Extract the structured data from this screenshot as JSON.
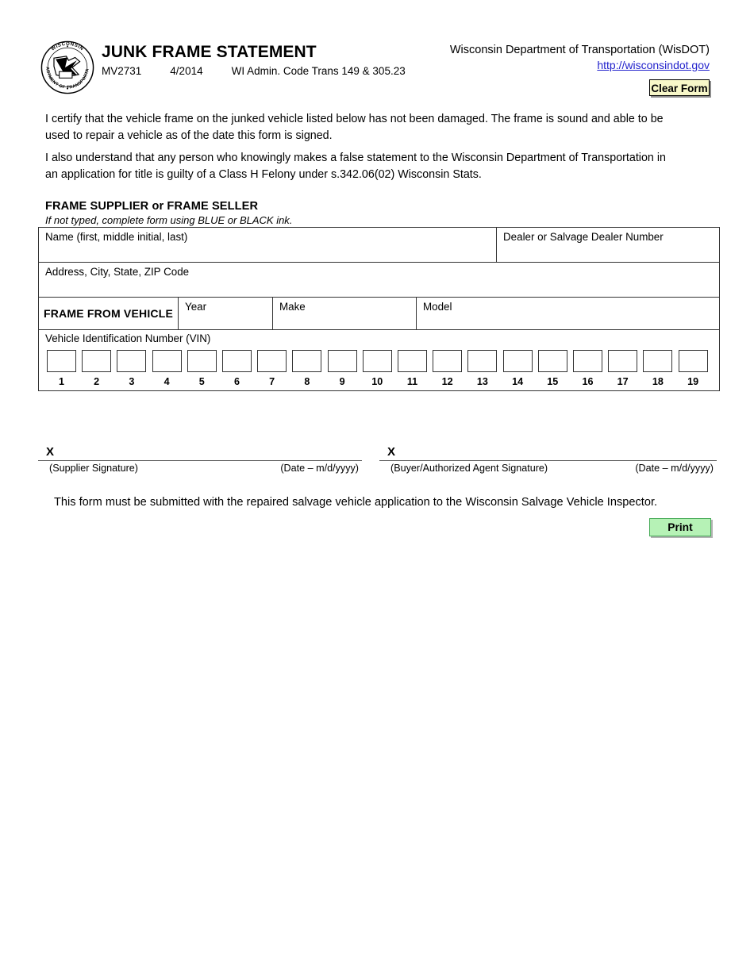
{
  "header": {
    "logo_alt": "wisconsin-dot-seal",
    "logo_ring_top": "WISCONSIN",
    "logo_ring_bottom": "DEPARTMENT OF TRANSPORTATION",
    "title": "JUNK FRAME STATEMENT",
    "form_number": "MV2731",
    "revision_date": "4/2014",
    "code_reference": "WI Admin. Code Trans 149 & 305.23",
    "agency_name": "Wisconsin Department of Transportation (WisDOT)",
    "agency_url": "http://wisconsindot.gov",
    "clear_form_label": "Clear Form"
  },
  "certification": {
    "paragraph_1": "I certify that the vehicle frame on the junked vehicle listed below has not been damaged. The frame is sound and able to be used to repair a vehicle as of the date this form is signed.",
    "paragraph_2": "I also understand that any person who knowingly makes a false statement to the Wisconsin Department of Transportation in an application for title is guilty of a Class H Felony under s.342.06(02) Wisconsin Stats."
  },
  "section": {
    "heading": "FRAME SUPPLIER or FRAME SELLER",
    "subheading": "If not typed, complete form using BLUE or BLACK ink."
  },
  "table": {
    "name_label": "Name (first, middle initial, last)",
    "name_value": "",
    "dealer_label": "Dealer or Salvage Dealer Number",
    "dealer_value": "",
    "address_label": "Address, City, State, ZIP Code",
    "address_value": "",
    "frame_from_vehicle_label": "FRAME FROM VEHICLE",
    "year_label": "Year",
    "year_value": "",
    "make_label": "Make",
    "make_value": "",
    "model_label": "Model",
    "model_value": "",
    "vin_label": "Vehicle Identification Number (VIN)",
    "vin_positions": [
      "1",
      "2",
      "3",
      "4",
      "5",
      "6",
      "7",
      "8",
      "9",
      "10",
      "11",
      "12",
      "13",
      "14",
      "15",
      "16",
      "17",
      "18",
      "19"
    ],
    "vin_values": [
      "",
      "",
      "",
      "",
      "",
      "",
      "",
      "",
      "",
      "",
      "",
      "",
      "",
      "",
      "",
      "",
      "",
      "",
      ""
    ]
  },
  "signatures": {
    "x_mark": "X",
    "supplier_caption": "(Supplier Signature)",
    "supplier_date_caption": "(Date – m/d/yyyy)",
    "buyer_caption": "(Buyer/Authorized Agent Signature)",
    "buyer_date_caption": "(Date – m/d/yyyy)"
  },
  "footer": {
    "note": "This form must be submitted with the repaired salvage vehicle application to the Wisconsin Salvage Vehicle Inspector.",
    "print_label": "Print"
  },
  "colors": {
    "clear_form_bg": "#f7f7c8",
    "print_bg": "#b6f2b6",
    "print_border": "#44aa55",
    "link": "#2222cc",
    "rule": "#333333"
  }
}
